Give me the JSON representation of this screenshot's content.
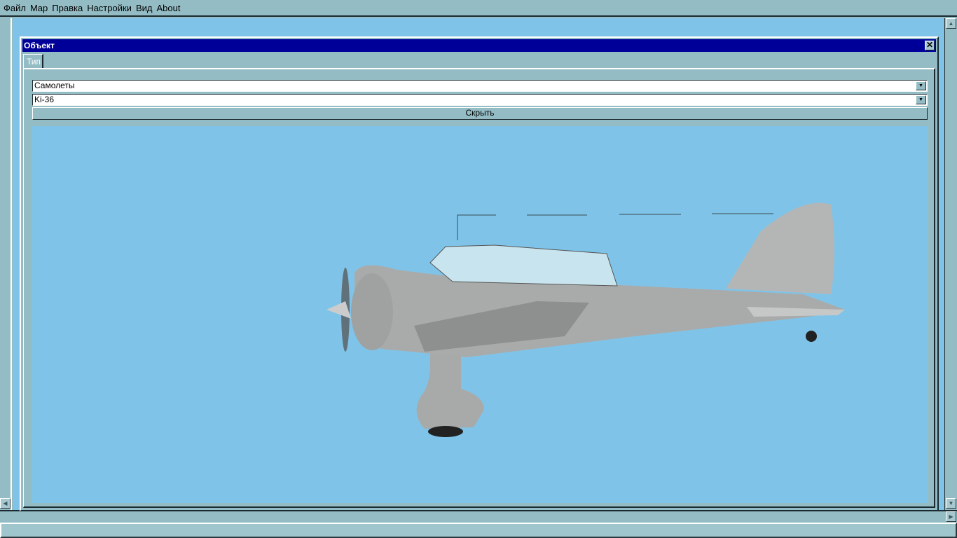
{
  "menu": [
    "Файл",
    "Map",
    "Правка",
    "Настройки",
    "Вид",
    "About"
  ],
  "window": {
    "title": "Объект",
    "close": "✕",
    "tab": "Тип",
    "category_select": "Самолеты",
    "model_select": "Ki-36",
    "hide_button": "Скрыть"
  },
  "scroll_icons": {
    "up": "▲",
    "left": "◀",
    "right": "▶",
    "down": "▼"
  }
}
